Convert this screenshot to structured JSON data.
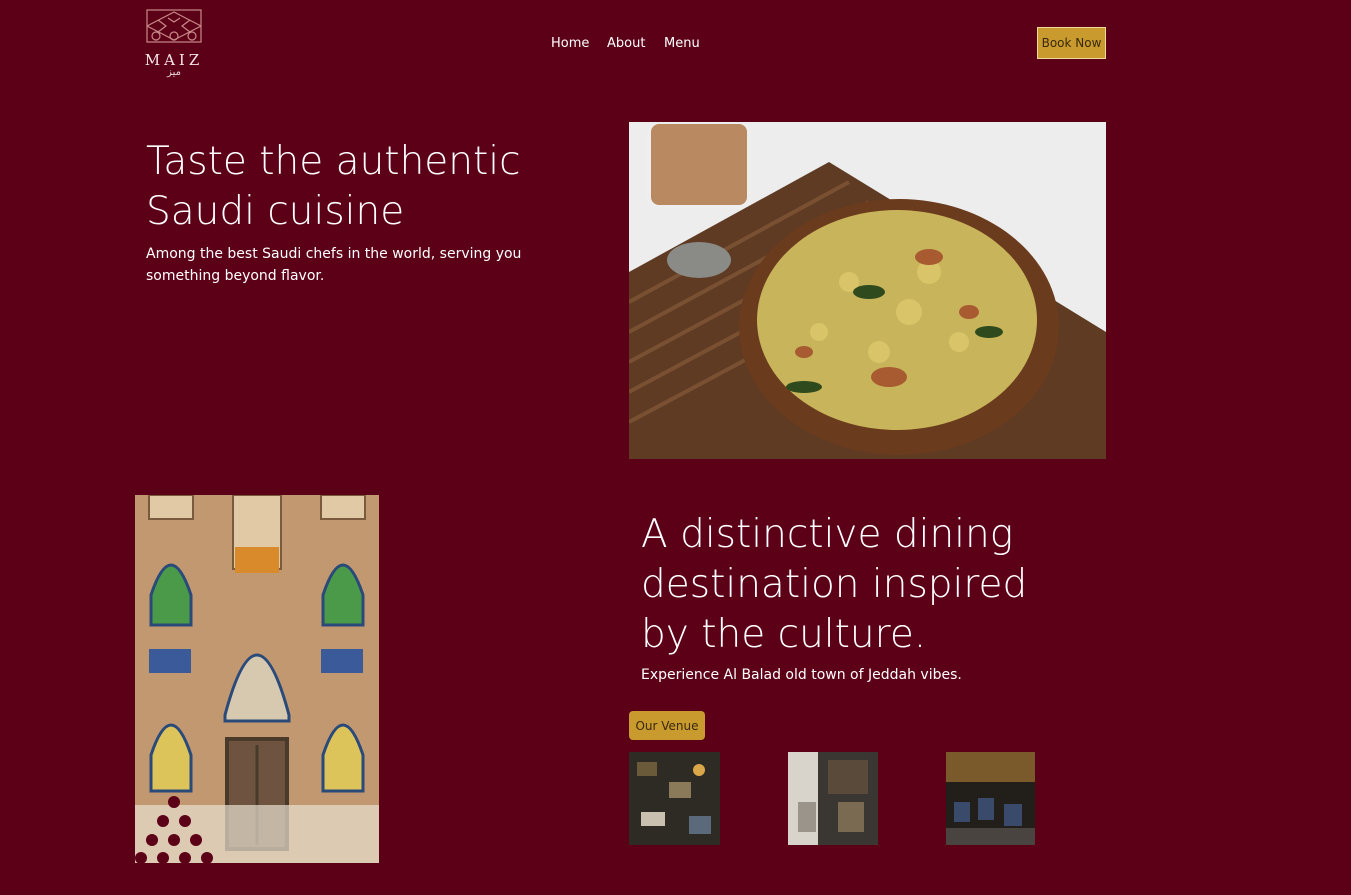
{
  "brand": {
    "logo_icon": "maiz-logo-icon",
    "name": "MAIZ",
    "name_arabic": "ميز"
  },
  "nav": {
    "items": [
      {
        "label": "Home"
      },
      {
        "label": "About"
      },
      {
        "label": "Menu"
      }
    ],
    "book_label": "Book Now"
  },
  "hero": {
    "title": "Taste the authentic Saudi cuisine",
    "subtitle": "Among the best Saudi chefs in the world, serving you something beyond flavor.",
    "image": "poha-bowl-image"
  },
  "culture": {
    "image": "tiled-facade-image",
    "title": "A distinctive dining destination inspired by the culture.",
    "subtitle": "Experience Al Balad old town of Jeddah vibes.",
    "button_label": "Our Venue",
    "thumbnails": [
      "venue-photo-1",
      "venue-photo-2",
      "venue-photo-3"
    ]
  },
  "colors": {
    "background": "#5c0018",
    "accent": "#c99a2e",
    "text": "#ffffff"
  }
}
